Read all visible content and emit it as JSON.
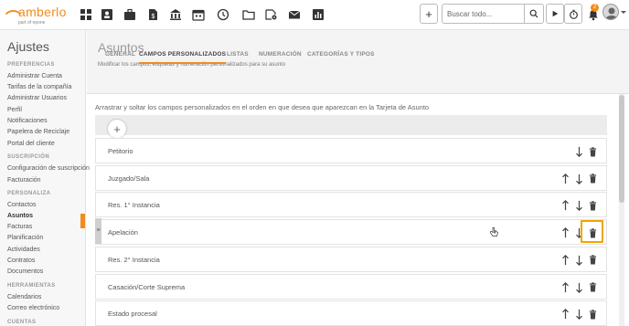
{
  "brand": {
    "name": "amberlo",
    "tagline": "part of epone"
  },
  "topbar": {
    "icons": [
      "dashboard-icon",
      "contacts-icon",
      "cases-icon",
      "documents-icon",
      "institutions-icon",
      "calendar-icon",
      "timer-history-icon",
      "folder-icon",
      "folder-settings-icon",
      "mail-icon",
      "reports-icon"
    ],
    "add_label": "+",
    "search_placeholder": "Buscar todo...",
    "notification_count": "2"
  },
  "sidebar": {
    "title": "Ajustes",
    "sections": [
      {
        "heading": "PREFERENCIAS",
        "items": [
          "Administrar Cuenta",
          "Tarifas de la compañía",
          "Administrar Usuarios",
          "Perfil",
          "Notificaciones",
          "Papelera de Reciclaje",
          "Portal del cliente"
        ]
      },
      {
        "heading": "SUSCRIPCIÓN",
        "items": [
          "Configuración de suscripción",
          "Facturación"
        ]
      },
      {
        "heading": "PERSONALIZA",
        "items": [
          "Contactos",
          "Asuntos",
          "Facturas",
          "Planificación",
          "Actividades",
          "Contratos",
          "Documentos"
        ]
      },
      {
        "heading": "HERRAMIENTAS",
        "items": [
          "Calendarios",
          "Correo electrónico"
        ]
      },
      {
        "heading": "CUENTAS",
        "items": []
      }
    ],
    "active_item": "Asuntos"
  },
  "main": {
    "title": "Asuntos",
    "description": "Modificar los campos, etiquetas y numeración personalizados para su asunto",
    "tabs": [
      "GENERAL",
      "CAMPOS PERSONALIZADOS",
      "LISTAS",
      "NUMERACIÓN",
      "CATEGORÍAS Y TIPOS"
    ],
    "active_tab": "CAMPOS PERSONALIZADOS",
    "instructions": "Arrastrar y soltar los campos personalizados en el orden en que desea que aparezcan en la Tarjeta de Asunto",
    "add_button": "+",
    "fields": [
      {
        "label": "Petitorio",
        "up": false
      },
      {
        "label": "Juzgado/Sala",
        "up": true
      },
      {
        "label": "Res. 1° Instancia",
        "up": true
      },
      {
        "label": "Apelación",
        "up": true,
        "dragging": true
      },
      {
        "label": "Res. 2° Instancia",
        "up": true
      },
      {
        "label": "Casación/Corte Suprema",
        "up": true
      },
      {
        "label": "Estado procesal",
        "up": true
      }
    ]
  },
  "colors": {
    "accent": "#f08c1e",
    "highlight": "#f0a500"
  }
}
